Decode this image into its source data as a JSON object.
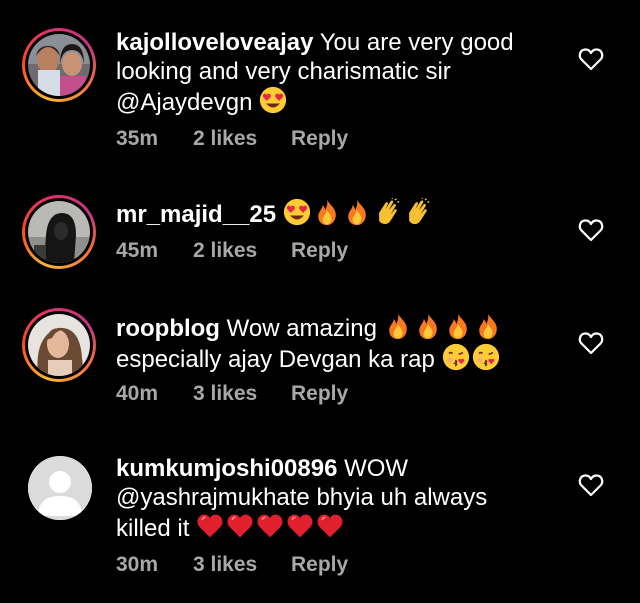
{
  "comments": [
    {
      "username": "kajolloveloveajay",
      "text_lines": [
        "You  are very good",
        "looking and very charismatic sir",
        "@Ajaydevgn"
      ],
      "emoji": [
        "heart-eyes"
      ],
      "time": "35m",
      "likes": "2 likes",
      "reply": "Reply",
      "avatar": "couple-photo"
    },
    {
      "username": "mr_majid__25",
      "text_lines": [
        ""
      ],
      "emoji": [
        "heart-eyes",
        "fire",
        "fire",
        "clap",
        "clap"
      ],
      "time": "45m",
      "likes": "2 likes",
      "reply": "Reply",
      "avatar": "hooded-man-photo"
    },
    {
      "username": "roopblog",
      "text_lines": [
        "Wow amazing",
        "especially ajay Devgan ka rap"
      ],
      "emoji_line1": [
        "fire",
        "fire",
        "fire",
        "fire"
      ],
      "emoji_line2": [
        "kiss",
        "kiss"
      ],
      "time": "40m",
      "likes": "3 likes",
      "reply": "Reply",
      "avatar": "woman-photo"
    },
    {
      "username": "kumkumjoshi00896",
      "text_lines": [
        "WOW",
        "@yashrajmukhate bhyia uh always",
        "killed it"
      ],
      "emoji": [
        "red-heart",
        "red-heart",
        "red-heart",
        "red-heart",
        "red-heart"
      ],
      "time": "30m",
      "likes": "3 likes",
      "reply": "Reply",
      "avatar": "default-avatar"
    }
  ],
  "icons": {
    "like": "heart-outline-icon"
  },
  "colors": {
    "background": "#000000",
    "text": "#ffffff",
    "meta": "#a8a8a8",
    "avatar_ring_start": "#f7b733",
    "avatar_ring_end": "#c13584"
  }
}
